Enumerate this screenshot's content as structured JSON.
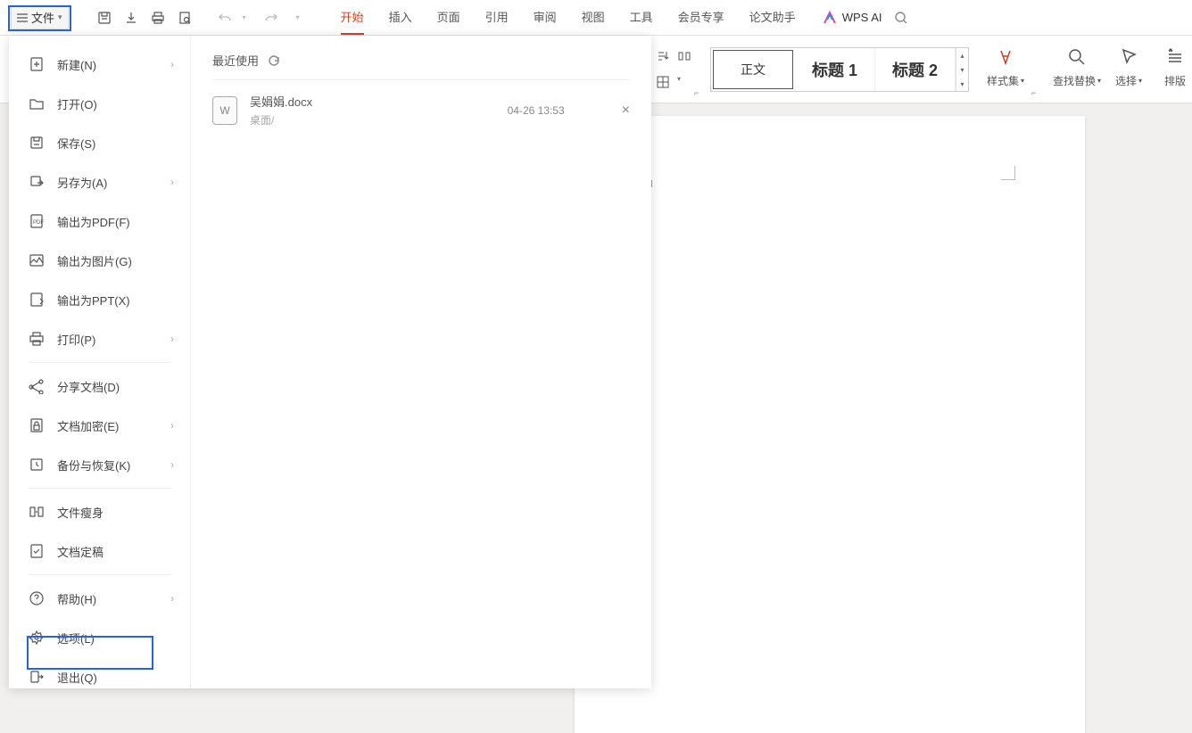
{
  "topbar": {
    "file_label": "文件",
    "tabs": [
      "开始",
      "插入",
      "页面",
      "引用",
      "审阅",
      "视图",
      "工具",
      "会员专享",
      "论文助手"
    ],
    "wps_ai": "WPS AI"
  },
  "ribbon": {
    "styles": {
      "normal": "正文",
      "h1": "标题 1",
      "h2": "标题 2"
    },
    "buttons": {
      "styleset": "样式集",
      "findreplace": "查找替换",
      "select": "选择",
      "arrange": "排版"
    }
  },
  "file_menu": {
    "items": [
      {
        "key": "new",
        "label": "新建(N)",
        "arrow": true
      },
      {
        "key": "open",
        "label": "打开(O)"
      },
      {
        "key": "save",
        "label": "保存(S)"
      },
      {
        "key": "saveas",
        "label": "另存为(A)",
        "arrow": true
      },
      {
        "key": "exportpdf",
        "label": "输出为PDF(F)"
      },
      {
        "key": "exportimg",
        "label": "输出为图片(G)"
      },
      {
        "key": "exportppt",
        "label": "输出为PPT(X)"
      },
      {
        "key": "print",
        "label": "打印(P)",
        "arrow": true
      },
      {
        "sep": true
      },
      {
        "key": "share",
        "label": "分享文档(D)"
      },
      {
        "key": "encrypt",
        "label": "文档加密(E)",
        "arrow": true
      },
      {
        "key": "backup",
        "label": "备份与恢复(K)",
        "arrow": true
      },
      {
        "sep": true
      },
      {
        "key": "slim",
        "label": "文件瘦身"
      },
      {
        "key": "finalize",
        "label": "文档定稿"
      },
      {
        "sep": true
      },
      {
        "key": "help",
        "label": "帮助(H)",
        "arrow": true
      },
      {
        "key": "options",
        "label": "选项(L)"
      },
      {
        "key": "exit",
        "label": "退出(Q)"
      }
    ],
    "recent_header": "最近使用",
    "recent_items": [
      {
        "name": "吴娟娟.docx",
        "path": "桌面/",
        "time": "04-26 13:53"
      }
    ]
  },
  "icons": {
    "file_new": "new",
    "file_open": "open",
    "file_save": "save"
  }
}
